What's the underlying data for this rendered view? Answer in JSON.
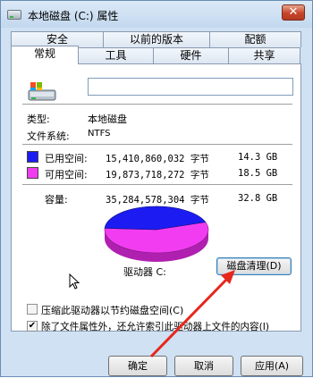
{
  "window": {
    "title": "本地磁盘 (C:) 属性",
    "close": "✕"
  },
  "tabs": {
    "row1": [
      "安全",
      "以前的版本",
      "配额"
    ],
    "row2": [
      "常规",
      "工具",
      "硬件",
      "共享"
    ],
    "active": "常规"
  },
  "general": {
    "drive_name_value": "",
    "type_label": "类型:",
    "type_value": "本地磁盘",
    "fs_label": "文件系统:",
    "fs_value": "NTFS",
    "used": {
      "label": "已用空间:",
      "bytes": "15,410,860,032 字节",
      "size": "14.3 GB",
      "color": "#1c1cf2"
    },
    "free": {
      "label": "可用空间:",
      "bytes": "19,873,718,272 字节",
      "size": "18.5 GB",
      "color": "#f23cf2"
    },
    "capacity": {
      "label": "容量:",
      "bytes": "35,284,578,304 字节",
      "size": "32.8 GB"
    },
    "drive_label": "驱动器 C:",
    "cleanup_button": "磁盘清理(D)",
    "compress_label": "压缩此驱动器以节约磁盘空间(C)",
    "compress_checked": false,
    "index_label": "除了文件属性外，还允许索引此驱动器上文件的内容(I)",
    "index_checked": true
  },
  "footer": {
    "ok": "确定",
    "cancel": "取消",
    "apply": "应用(A)"
  },
  "pie": {
    "used_fraction": 0.437
  }
}
